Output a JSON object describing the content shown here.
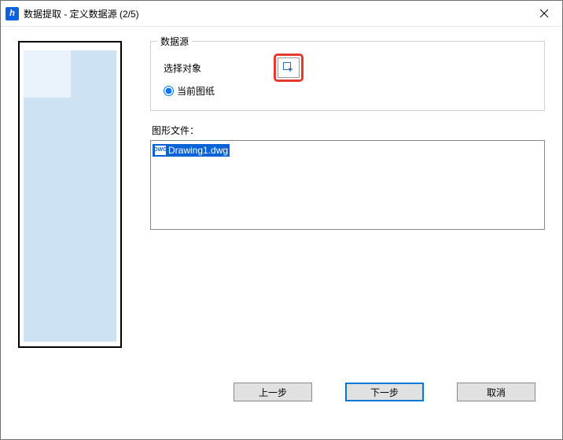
{
  "window": {
    "title": "数据提取 - 定义数据源 (2/5)"
  },
  "group": {
    "legend": "数据源",
    "select_objects_label": "选择对象",
    "radio_current_drawing": "当前图纸"
  },
  "files": {
    "label": "图形文件：",
    "item": "Drawing1.dwg"
  },
  "buttons": {
    "prev": "上一步",
    "next": "下一步",
    "cancel": "取消"
  }
}
